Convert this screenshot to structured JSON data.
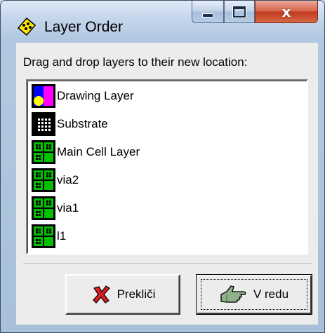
{
  "window": {
    "title": "Layer Order",
    "close_glyph": "x"
  },
  "instruction": "Drag and drop layers to their new location:",
  "layers": [
    {
      "label": "Drawing Layer",
      "icon": "drawing-layer-icon"
    },
    {
      "label": "Substrate",
      "icon": "substrate-icon"
    },
    {
      "label": "Main Cell Layer",
      "icon": "cell-layer-icon"
    },
    {
      "label": "via2",
      "icon": "cell-layer-icon"
    },
    {
      "label": "via1",
      "icon": "cell-layer-icon"
    },
    {
      "label": "l1",
      "icon": "cell-layer-icon"
    }
  ],
  "buttons": {
    "cancel_label": "Prekliči",
    "ok_label": "V redu"
  },
  "colors": {
    "cell_green": "#00c000",
    "drawing_magenta": "#ff00ff",
    "drawing_blue": "#0000ff",
    "drawing_yellow": "#ffff00"
  }
}
